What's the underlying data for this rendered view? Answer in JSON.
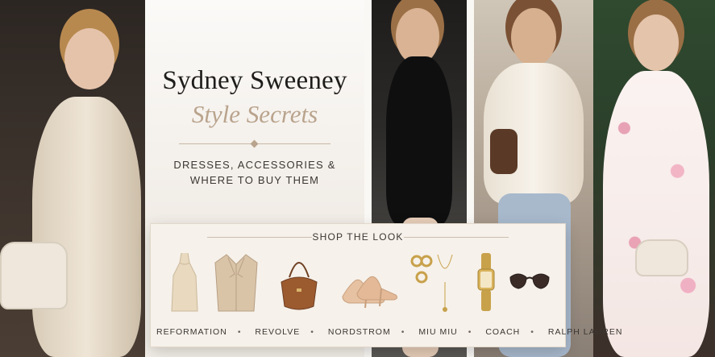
{
  "hero": {
    "title": "Sydney Sweeney",
    "subtitle_script": "Style Secrets",
    "subtitle_line1": "DRESSES, ACCESSORIES &",
    "subtitle_line2": "WHERE TO BUY THEM"
  },
  "shop_the_look": {
    "header": "SHOP THE LOOK",
    "items": [
      {
        "icon": "slip-dress-icon"
      },
      {
        "icon": "blazer-icon"
      },
      {
        "icon": "brown-handbag-icon"
      },
      {
        "icon": "nude-heels-icon"
      },
      {
        "icon": "gold-earrings-icon"
      },
      {
        "icon": "gold-necklace-icon"
      },
      {
        "icon": "gold-watch-icon"
      },
      {
        "icon": "sunglasses-icon"
      }
    ],
    "retailers": [
      "REFORMATION",
      "REVOLVE",
      "NORDSTROM",
      "MIU MIU",
      "COACH",
      "RALPH LAUREN"
    ]
  },
  "colors": {
    "background": "#f3efe8",
    "accent": "#b9a38c",
    "text_dark": "#1f1d1b"
  }
}
